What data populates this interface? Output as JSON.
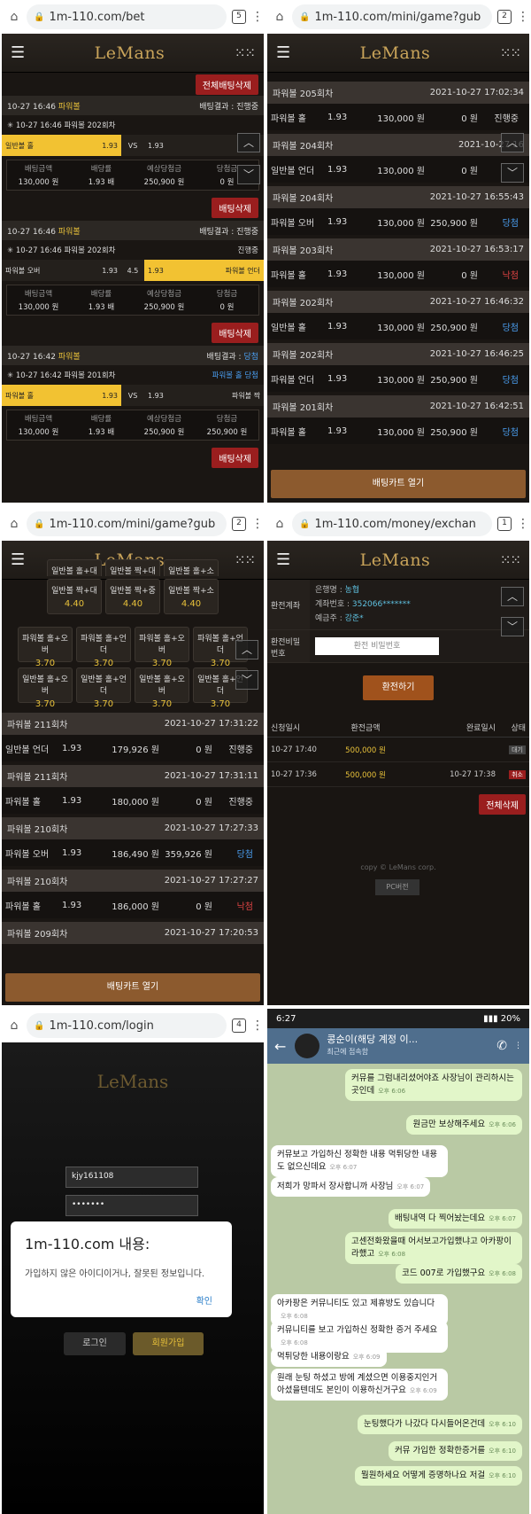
{
  "p1": {
    "url": "1m-110.com/bet",
    "tabs_count": "5",
    "logo": "LeMans",
    "delete_all": "전체배팅삭제",
    "bets": [
      {
        "time": "10-27 16:46",
        "game": "파워볼",
        "result_label": "배팅결과 :",
        "result": "진행중",
        "sub_time": "10-27 16:46",
        "round": "파워볼 202회차",
        "sub_status": "",
        "left_label": "일반볼 홀",
        "left_odds": "1.93",
        "mid": "VS",
        "right_odds": "1.93",
        "right_label": "",
        "selected": "left",
        "amount_l": "배팅금액",
        "amount": "130,000 원",
        "odds_l": "배당률",
        "odds": "1.93 배",
        "exp_l": "예상당첨금",
        "exp": "250,900 원",
        "win_l": "당첨금",
        "win": "0 원",
        "delete": "배팅삭제"
      },
      {
        "time": "10-27 16:46",
        "game": "파워볼",
        "result_label": "배팅결과 :",
        "result": "진행중",
        "sub_time": "10-27 16:46",
        "round": "파워볼 202회차",
        "sub_status": "진행중",
        "left_label": "파워볼 오버",
        "left_odds": "1.93",
        "mid": "4.5",
        "right_odds": "1.93",
        "right_label": "파워볼 언더",
        "selected": "right",
        "amount_l": "배팅금액",
        "amount": "130,000 원",
        "odds_l": "배당률",
        "odds": "1.93 배",
        "exp_l": "예상당첨금",
        "exp": "250,900 원",
        "win_l": "당첨금",
        "win": "0 원",
        "delete": "배팅삭제"
      },
      {
        "time": "10-27 16:42",
        "game": "파워볼",
        "result_label": "배팅결과 :",
        "result": "당첨",
        "sub_time": "10-27 16:42",
        "round": "파워볼 201회차",
        "sub_status": "파워볼 홀 당첨",
        "left_label": "파워볼 홀",
        "left_odds": "1.93",
        "mid": "VS",
        "right_odds": "1.93",
        "right_label": "파워볼 짝",
        "selected": "left",
        "amount_l": "배팅금액",
        "amount": "130,000 원",
        "odds_l": "배당률",
        "odds": "1.93 배",
        "exp_l": "예상당첨금",
        "exp": "250,900 원",
        "win_l": "당첨금",
        "win": "250,900 원",
        "delete": "배팅삭제"
      }
    ]
  },
  "p2": {
    "url": "1m-110.com/mini/game?gub",
    "tabs_count": "2",
    "logo": "LeMans",
    "rows": [
      {
        "round": "파워볼 205회차",
        "date": "2021-10-27 17:02:34",
        "pick": "파워볼 홀",
        "odds": "1.93",
        "amount": "130,000 원",
        "win": "0 원",
        "status": "진행중",
        "cls": ""
      },
      {
        "round": "파워볼 204회차",
        "date": "2021-10-27 16",
        "pick": "일반볼 언더",
        "odds": "1.93",
        "amount": "130,000 원",
        "win": "0 원",
        "status": "",
        "cls": "red"
      },
      {
        "round": "파워볼 204회차",
        "date": "2021-10-27 16:55:43",
        "pick": "파워볼 오버",
        "odds": "1.93",
        "amount": "130,000 원",
        "win": "250,900 원",
        "status": "당첨",
        "cls": "blue"
      },
      {
        "round": "파워볼 203회차",
        "date": "2021-10-27 16:53:17",
        "pick": "파워볼 홀",
        "odds": "1.93",
        "amount": "130,000 원",
        "win": "0 원",
        "status": "낙첨",
        "cls": "red"
      },
      {
        "round": "파워볼 202회차",
        "date": "2021-10-27 16:46:32",
        "pick": "일반볼 홀",
        "odds": "1.93",
        "amount": "130,000 원",
        "win": "250,900 원",
        "status": "당첨",
        "cls": "blue"
      },
      {
        "round": "파워볼 202회차",
        "date": "2021-10-27 16:46:25",
        "pick": "파워볼 언더",
        "odds": "1.93",
        "amount": "130,000 원",
        "win": "250,900 원",
        "status": "당첨",
        "cls": "blue"
      },
      {
        "round": "파워볼 201회차",
        "date": "2021-10-27 16:42:51",
        "pick": "파워볼 홀",
        "odds": "1.93",
        "amount": "130,000 원",
        "win": "250,900 원",
        "status": "당첨",
        "cls": "blue"
      }
    ],
    "cart": "배팅카트 열기"
  },
  "p3": {
    "url": "1m-110.com/mini/game?gub",
    "tabs_count": "2",
    "logo": "LeMans",
    "top_odds": [
      {
        "l": "일반볼 홀+대",
        "v": "4.40"
      },
      {
        "l": "일반볼 짝+대",
        "v": "4.40"
      },
      {
        "l": "일반볼 홀+소",
        "v": "4.40"
      }
    ],
    "odds_row1": [
      {
        "l": "일반볼 짝+대",
        "v": "4.40"
      },
      {
        "l": "일반볼 짝+중",
        "v": "4.40"
      },
      {
        "l": "일반볼 짝+소",
        "v": "4.40"
      }
    ],
    "odds_row2": [
      {
        "l": "파워볼 홀+오버",
        "v": "3.70"
      },
      {
        "l": "파워볼 홀+언더",
        "v": "3.70"
      },
      {
        "l": "파워볼 홀+오버",
        "v": "3.70"
      },
      {
        "l": "파워볼 홀+언더",
        "v": "3.70"
      }
    ],
    "odds_row3": [
      {
        "l": "일반볼 홀+오버",
        "v": "3.70"
      },
      {
        "l": "일반볼 홀+언더",
        "v": "3.70"
      },
      {
        "l": "일반볼 홀+오버",
        "v": "3.70"
      },
      {
        "l": "일반볼 홀+언더",
        "v": "3.70"
      }
    ],
    "rows": [
      {
        "round": "파워볼 211회차",
        "date": "2021-10-27 17:31:22",
        "pick": "일반볼 언더",
        "odds": "1.93",
        "amount": "179,926 원",
        "win": "0 원",
        "status": "진행중",
        "cls": ""
      },
      {
        "round": "파워볼 211회차",
        "date": "2021-10-27 17:31:11",
        "pick": "파워볼 홀",
        "odds": "1.93",
        "amount": "180,000 원",
        "win": "0 원",
        "status": "진행중",
        "cls": ""
      },
      {
        "round": "파워볼 210회차",
        "date": "2021-10-27 17:27:33",
        "pick": "파워볼 오버",
        "odds": "1.93",
        "amount": "186,490 원",
        "win": "359,926 원",
        "status": "당첨",
        "cls": "blue"
      },
      {
        "round": "파워볼 210회차",
        "date": "2021-10-27 17:27:27",
        "pick": "파워볼 홀",
        "odds": "1.93",
        "amount": "186,000 원",
        "win": "0 원",
        "status": "낙첨",
        "cls": "red"
      }
    ],
    "last_round": "파워볼 209회차",
    "last_date": "2021-10-27 17:20:53",
    "cart": "배팅카트 열기"
  },
  "p4": {
    "url": "1m-110.com/money/exchan",
    "tabs_count": "1",
    "logo": "LeMans",
    "acct_label": "환전계좌",
    "bank_k": "은행명 : ",
    "bank": "농협",
    "acct_k": "계좌번호 : ",
    "acct": "352066*******",
    "holder_k": "예금주 : ",
    "holder": "강준*",
    "pwd_label": "환전비밀번호",
    "pwd_placeholder": "환전 비밀번호",
    "submit": "환전하기",
    "hist_head": [
      "신청일시",
      "환전금액",
      "완료일시",
      "상태"
    ],
    "hist": [
      {
        "req": "10-27 17:40",
        "amt": "500,000 원",
        "done": "",
        "status": "대기",
        "cls": ""
      },
      {
        "req": "10-27 17:36",
        "amt": "500,000 원",
        "done": "10-27 17:38",
        "status": "취소",
        "cls": "cancel"
      }
    ],
    "delete_all": "전체삭제",
    "copy": "copy © LeMans corp.",
    "pc": "PC버전"
  },
  "p5": {
    "url": "1m-110.com/login",
    "tabs_count": "4",
    "logo": "LeMans",
    "user_id": "kjy161108",
    "password": "•••••••",
    "dialog_title": "1m-110.com 내용:",
    "dialog_msg": "가입하지 않은 아이디이거나, 잘못된 정보입니다.",
    "dialog_ok": "확인",
    "login": "로그인",
    "join": "회원가입"
  },
  "p6": {
    "time": "6:27",
    "battery": "20%",
    "chat_name": "콩순이(해당 계정 이...",
    "chat_sub": "최근에 접속함",
    "messages": [
      {
        "dir": "out",
        "text": "커뮤를 그럼내리셨어야죠 사장님이 관리하시는곳인데",
        "time": "오후 6:06"
      },
      {
        "dir": "out",
        "text": "원금만 보상해주세요",
        "time": "오후 6:06"
      },
      {
        "dir": "in",
        "text": "커뮤보고 가입하신 정확한 내용 먹튀당한 내용도 없으신데요",
        "time": "오후 6:07"
      },
      {
        "dir": "in",
        "text": "저희가 망파서 장사합니까 사장님",
        "time": "오후 6:07"
      },
      {
        "dir": "out",
        "text": "배팅내역 다 찍어놨는데요",
        "time": "오후 6:07"
      },
      {
        "dir": "out",
        "text": "고센전화왔을때 어서보고가입했냐고 아카팡이라했고",
        "time": "오후 6:08"
      },
      {
        "dir": "out",
        "text": "코드 007로 가입했구요",
        "time": "오후 6:08"
      },
      {
        "dir": "in",
        "text": "아카팡은 커뮤니티도 있고 제휴방도 있습니다",
        "time": "오후 6:08"
      },
      {
        "dir": "in",
        "text": "커뮤니티를 보고 가입하신 정확한 증거 주세요",
        "time": "오후 6:08"
      },
      {
        "dir": "in",
        "text": "먹튀당한 내용이랑요",
        "time": "오후 6:09"
      },
      {
        "dir": "in",
        "text": "원래 눈팅 하셨고 방에 계셨으면 이용중지인거 아셨을텐데도 본인이 이용하신거구요",
        "time": "오후 6:09"
      },
      {
        "dir": "out",
        "text": "눈팅했다가 나갔다 다시들어온건데",
        "time": "오후 6:10"
      },
      {
        "dir": "out",
        "text": "커뮤 가입한 정확한증거를",
        "time": "오후 6:10"
      },
      {
        "dir": "out",
        "text": "뭘원하세요 어떻게 증명하나요 저걸",
        "time": "오후 6:10"
      }
    ]
  }
}
